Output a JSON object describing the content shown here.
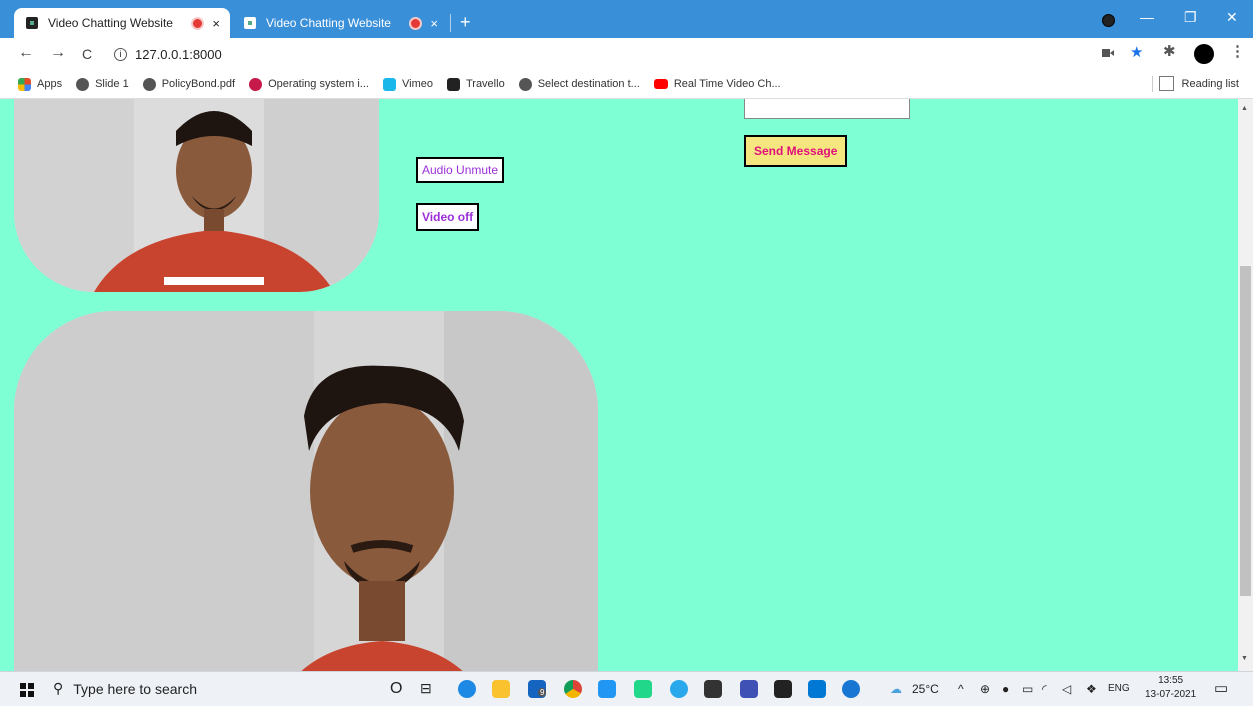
{
  "browser": {
    "tabs": [
      {
        "title": "Video Chatting Website",
        "active": true
      },
      {
        "title": "Video Chatting Website",
        "active": false
      }
    ],
    "new_tab": "+",
    "close_glyph": "×",
    "url": "127.0.0.1:8000",
    "url_icon": "info-icon",
    "nav": {
      "back": "←",
      "forward": "→",
      "reload": "C"
    },
    "window": {
      "minimize": "—",
      "restore": "❐",
      "close": "✕"
    }
  },
  "bookmarks": {
    "items": [
      {
        "label": "Apps",
        "icon": "apps-grid-icon",
        "color": "#e34c26"
      },
      {
        "label": "Slide 1",
        "icon": "globe-icon",
        "color": "#555555"
      },
      {
        "label": "PolicyBond.pdf",
        "icon": "globe-icon",
        "color": "#555555"
      },
      {
        "label": "Operating system i...",
        "icon": "raspberry-icon",
        "color": "#c51a4a"
      },
      {
        "label": "Vimeo",
        "icon": "vimeo-icon",
        "color": "#1ab7ea"
      },
      {
        "label": "Travello",
        "icon": "travello-icon",
        "color": "#222222"
      },
      {
        "label": "Select destination t...",
        "icon": "globe-icon",
        "color": "#555555"
      },
      {
        "label": "Real Time Video Ch...",
        "icon": "youtube-icon",
        "color": "#ff0000"
      }
    ],
    "reading_list": "Reading list"
  },
  "page": {
    "audio_button": "Audio Unmute",
    "video_button": "Video off",
    "send_button": "Send Message",
    "message_input_value": "",
    "background": "#7fffd4"
  },
  "taskbar": {
    "search_placeholder": "Type here to search",
    "weather": "25°C",
    "language": "ENG",
    "time": "13:55",
    "date": "13-07-2021",
    "badge_count": "9"
  }
}
